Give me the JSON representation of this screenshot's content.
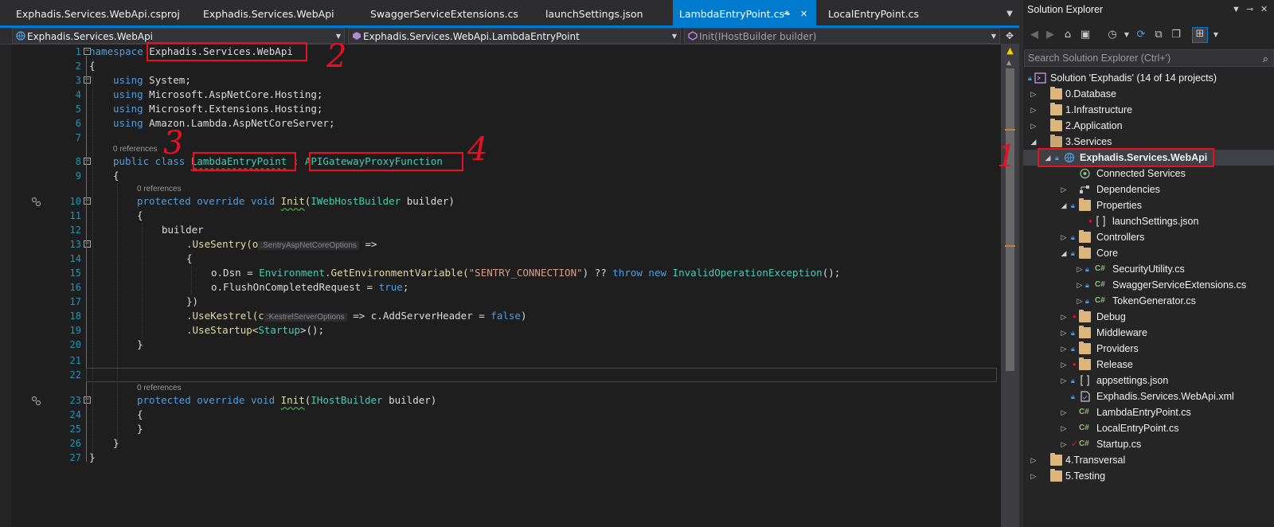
{
  "tabs": [
    {
      "label": "Exphadis.Services.WebApi.csproj",
      "active": false
    },
    {
      "label": "Exphadis.Services.WebApi",
      "active": false
    },
    {
      "label": "SwaggerServiceExtensions.cs",
      "active": false
    },
    {
      "label": "launchSettings.json",
      "active": false
    },
    {
      "label": "LambdaEntryPoint.cs*",
      "active": true
    },
    {
      "label": "LocalEntryPoint.cs",
      "active": false
    }
  ],
  "navbar": {
    "project": "Exphadis.Services.WebApi",
    "type": "Exphadis.Services.WebApi.LambdaEntryPoint",
    "member": "Init(IHostBuilder builder)"
  },
  "code": {
    "line_numbers": [
      "1",
      "2",
      "3",
      "4",
      "5",
      "6",
      "7",
      "8",
      "9",
      "10",
      "11",
      "12",
      "13",
      "14",
      "15",
      "16",
      "17",
      "18",
      "19",
      "20",
      "21",
      "22",
      "23",
      "24",
      "25",
      "26",
      "27"
    ],
    "lens_references": "0 references",
    "ns_kw": "namespace",
    "ns_name": "Exphadis.Services.WebApi",
    "brace_open": "{",
    "brace_close": "}",
    "using_kw": "using",
    "using_1": "System;",
    "using_2": "Microsoft.AspNetCore.Hosting;",
    "using_3": "Microsoft.Extensions.Hosting;",
    "using_4": "Amazon.Lambda.AspNetCoreServer;",
    "public_class": "public class",
    "class_name": "LambdaEntryPoint",
    "colon": ":",
    "base_class": "APIGatewayProxyFunction",
    "protected_override_void": "protected override void",
    "init": "Init",
    "iweb_host_builder": "IWebHostBuilder",
    "ihost_builder": "IHostBuilder",
    "builder_param": "builder)",
    "paren_open": "(",
    "builder": "builder",
    "use_sentry": ".UseSentry(o",
    "sentry_hint": ":SentryAspNetCoreOptions",
    "lambda_arrow": "=>",
    "dsn_assign": "o.Dsn = ",
    "environment": "Environment",
    "get_env": ".GetEnvironmentVariable(",
    "sentry_conn": "\"SENTRY_CONNECTION\"",
    "coalesce": ") ?? ",
    "throw_new": "throw new",
    "invalid_op": "InvalidOperationException",
    "end_call": "();",
    "flush": "o.FlushOnCompletedRequest = ",
    "true_kw": "true",
    "semicolon": ";",
    "close_paren_brace": "})",
    "use_kestrel": ".UseKestrel(c",
    "kestrel_hint": ":KestrelServerOptions",
    "add_server_header": "=> c.AddServerHeader = ",
    "false_kw": "false",
    "close_paren": ")",
    "use_startup": ".UseStartup<",
    "startup": "Startup",
    "use_startup_end": ">();"
  },
  "annotations": {
    "n1": "1",
    "n2": "2",
    "n3": "3",
    "n4": "4",
    "color": "#e81123"
  },
  "solution_explorer": {
    "title": "Solution Explorer",
    "search_placeholder": "Search Solution Explorer (Ctrl+')",
    "tree": [
      {
        "label": "Solution 'Exphadis' (14 of 14 projects)",
        "icon": "solution-icon"
      },
      {
        "label": "0.Database",
        "icon": "folder-icon"
      },
      {
        "label": "1.Infrastructure",
        "icon": "folder-icon"
      },
      {
        "label": "2.Application",
        "icon": "folder-icon"
      },
      {
        "label": "3.Services",
        "icon": "folder-open-icon"
      },
      {
        "label": "Exphadis.Services.WebApi",
        "icon": "web-project-icon"
      },
      {
        "label": "Connected Services",
        "icon": "connected-services-icon"
      },
      {
        "label": "Dependencies",
        "icon": "dependencies-icon"
      },
      {
        "label": "Properties",
        "icon": "properties-icon"
      },
      {
        "label": "launchSettings.json",
        "icon": "json-icon"
      },
      {
        "label": "Controllers",
        "icon": "folder-icon"
      },
      {
        "label": "Core",
        "icon": "folder-open-icon"
      },
      {
        "label": "SecurityUtility.cs",
        "icon": "csharp-icon"
      },
      {
        "label": "SwaggerServiceExtensions.cs",
        "icon": "csharp-icon"
      },
      {
        "label": "TokenGenerator.cs",
        "icon": "csharp-icon"
      },
      {
        "label": "Debug",
        "icon": "folder-icon"
      },
      {
        "label": "Middleware",
        "icon": "folder-icon"
      },
      {
        "label": "Providers",
        "icon": "folder-icon"
      },
      {
        "label": "Release",
        "icon": "folder-icon"
      },
      {
        "label": "appsettings.json",
        "icon": "json-icon"
      },
      {
        "label": "Exphadis.Services.WebApi.xml",
        "icon": "xml-icon"
      },
      {
        "label": "LambdaEntryPoint.cs",
        "icon": "csharp-icon"
      },
      {
        "label": "LocalEntryPoint.cs",
        "icon": "csharp-icon"
      },
      {
        "label": "Startup.cs",
        "icon": "csharp-icon"
      },
      {
        "label": "4.Transversal",
        "icon": "folder-icon"
      },
      {
        "label": "5.Testing",
        "icon": "folder-icon"
      }
    ]
  },
  "colors": {
    "accent": "#007acc",
    "keyword": "#569cd6",
    "type": "#4ec9b0",
    "method": "#dcdcaa",
    "string": "#d69d85",
    "line_number": "#2b91af"
  }
}
